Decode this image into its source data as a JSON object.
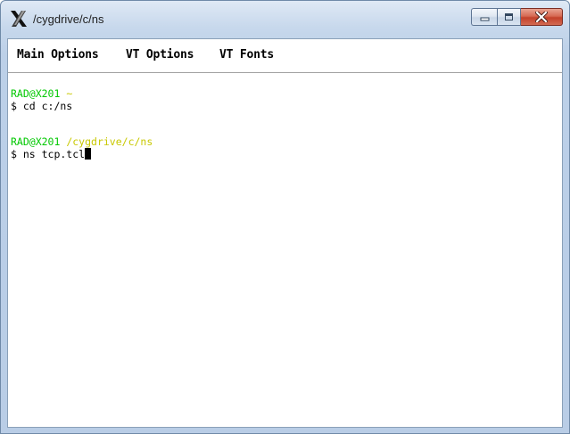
{
  "window": {
    "title": "/cygdrive/c/ns",
    "app_icon": "x-window-icon",
    "controls": {
      "minimize_icon": "minimize-icon",
      "maximize_icon": "maximize-icon",
      "close_icon": "close-icon"
    }
  },
  "menu": {
    "items": [
      {
        "label": "Main Options"
      },
      {
        "label": "VT Options"
      },
      {
        "label": "VT Fonts"
      }
    ]
  },
  "terminal": {
    "colors": {
      "prompt_user": "#00c800",
      "prompt_path": "#c8c800",
      "text": "#000000"
    },
    "lines": [
      {
        "user": "RAD@X201",
        "path": "~"
      },
      {
        "command": "$ cd c:/ns"
      },
      {
        "user": "RAD@X201",
        "path": "/cygdrive/c/ns"
      },
      {
        "command": "$ ns tcp.tcl"
      }
    ]
  }
}
